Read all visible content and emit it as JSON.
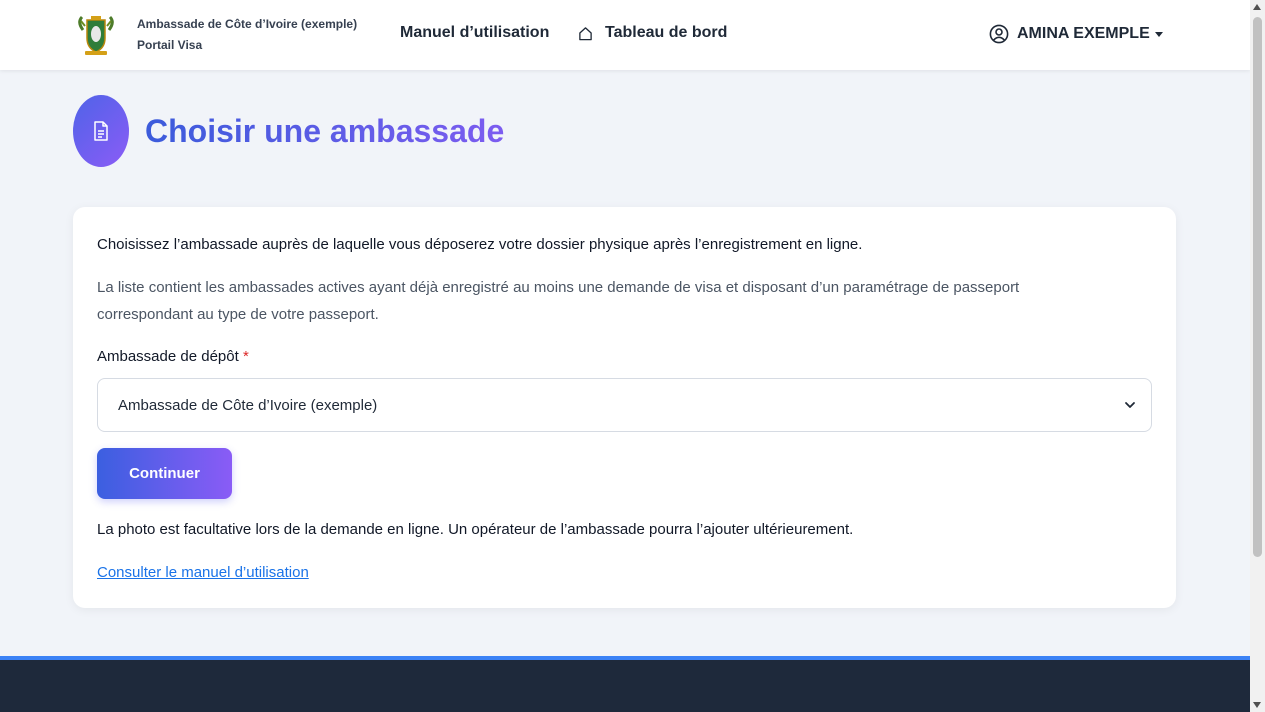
{
  "navbar": {
    "brand_line1": "Ambassade de Côte d’Ivoire (exemple)",
    "brand_line2": "Portail Visa",
    "logo_icon": "coat-of-arms-icon",
    "manual_link": "Manuel d’utilisation",
    "dashboard_link": "Tableau de bord",
    "dashboard_icon": "home-icon",
    "user_name": "AMINA EXEMPLE",
    "user_icon": "user-circle-icon"
  },
  "page": {
    "title": "Choisir une ambassade",
    "icon": "document-icon"
  },
  "card": {
    "intro": "Choisissez l’ambassade auprès de laquelle vous déposerez votre dossier physique après l’enregistrement en ligne.",
    "note": "La liste contient les ambassades actives ayant déjà enregistré au moins une demande de visa et disposant d’un paramétrage de passeport correspondant au type de votre passeport.",
    "select_label": "Ambassade de dépôt",
    "required_mark": "*",
    "select_value": "Ambassade de Côte d’Ivoire (exemple)",
    "continue_button": "Continuer",
    "photo_note": "La photo est facultative lors de la demande en ligne. Un opérateur de l’ambassade pourra l’ajouter ultérieurement.",
    "manual_link": "Consulter le manuel d’utilisation"
  },
  "colors": {
    "accent_start": "#3b5fe0",
    "accent_end": "#8a5cf6",
    "link": "#1a73e8",
    "footer": "#1e293b",
    "footer_border": "#3b82f6"
  }
}
